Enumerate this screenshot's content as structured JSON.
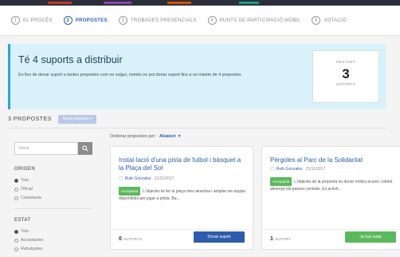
{
  "steps": [
    {
      "num": "1",
      "label": "El procés"
    },
    {
      "num": "2",
      "label": "Propostes"
    },
    {
      "num": "3",
      "label": "Trobades presencials"
    },
    {
      "num": "4",
      "label": "Punts de participació mòbil"
    },
    {
      "num": "5",
      "label": "Votació"
    }
  ],
  "banner": {
    "title": "Té 4 suports a distribuir",
    "text": "En lloc de donar suport a tantes propostes com es vulgui, només es pot donar suport fins a un màxim de 4 propostes.",
    "remaining_label": "Restant",
    "remaining_value": "3",
    "remaining_unit": "suports"
  },
  "proposals_bar": {
    "count": "3 PROPOSTES",
    "new_button": "Nova proposta ▾"
  },
  "sidebar": {
    "search_placeholder": "Cerca",
    "origin_title": "ORIGEN",
    "origin_options": [
      "Tots",
      "Oficial",
      "Ciutadania"
    ],
    "state_title": "ESTAT",
    "state_options": [
      "Tots",
      "Acceptades",
      "Rebutjades"
    ]
  },
  "order": {
    "label": "Ordenar propostes per:",
    "value": "Aleatori"
  },
  "cards": [
    {
      "title": "Instal·lació d'una pista de futbol i bàsquet a la Plaça del Sol",
      "author": "Ruth Gonzalez",
      "date": "21/11/2017",
      "tag": "Acceptada",
      "desc": "L'objectiu és fer la plaça més atractiva i ampliar els equips disponibles per jugar a pilota. Ba...",
      "supports_num": "0",
      "supports_label": "SUPORTS",
      "action_label": "Donar suport",
      "action_color": "#2d5cae"
    },
    {
      "title": "Pèrgoles al Parc de la Solidaritat",
      "author": "Ruth Gonzalez",
      "date": "21/11/2017",
      "tag": "Acceptada",
      "desc": "L'objectiu de la proposta és donar ombra al parc cobrint almenys els passos centrals. Es activit...",
      "supports_num": "1",
      "supports_label": "SUPORT",
      "action_label": "Ja has votat",
      "action_color": "#5cb85c"
    }
  ],
  "colors": {
    "accent": "#2d5cae",
    "banner_bg": "#d9f1f8",
    "banner_border": "#26a7d6",
    "success": "#5cb85c"
  }
}
